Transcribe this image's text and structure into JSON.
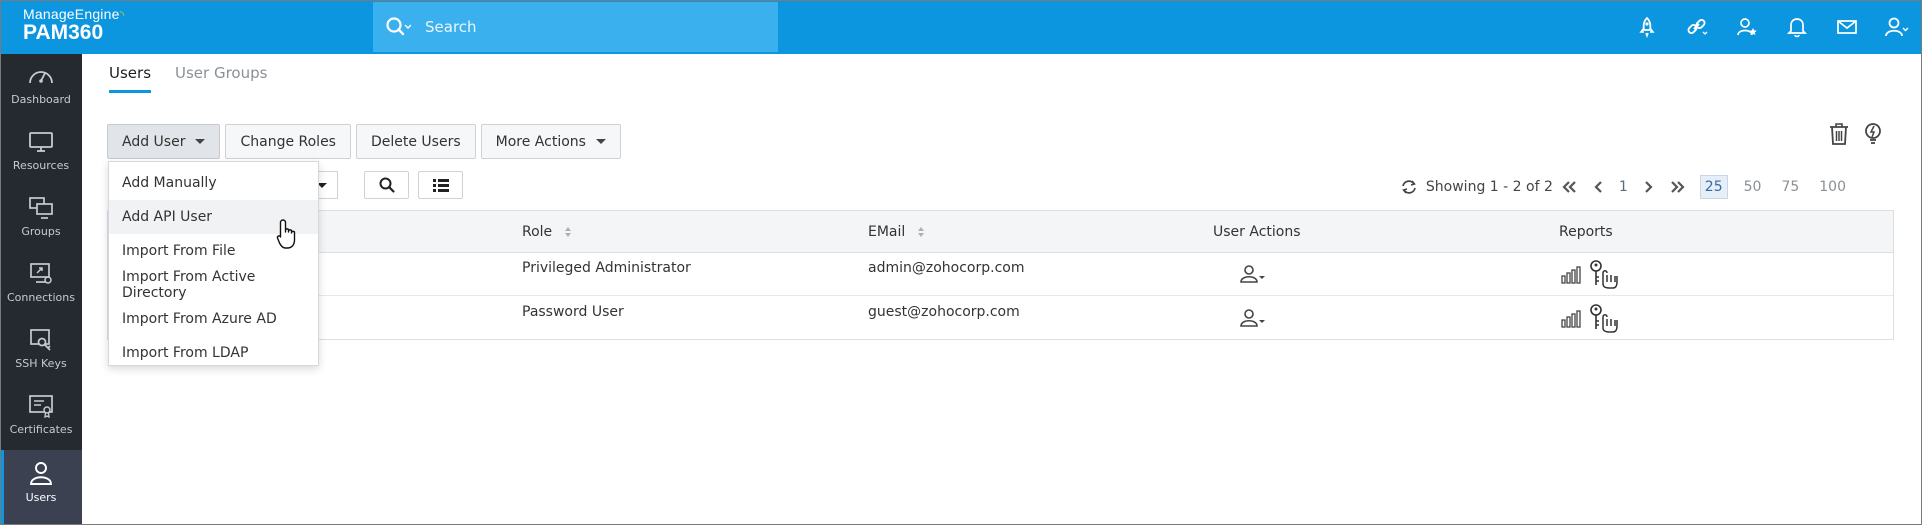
{
  "brand": {
    "vendor": "ManageEngine",
    "product": "PAM360"
  },
  "header": {
    "search_placeholder": "Search",
    "icons": [
      "rocket-icon",
      "link-icon",
      "user-star-icon",
      "bell-icon",
      "mail-icon",
      "user-profile-icon"
    ]
  },
  "sidebar": {
    "items": [
      {
        "label": "Dashboard",
        "icon": "dashboard-icon"
      },
      {
        "label": "Resources",
        "icon": "monitor-icon"
      },
      {
        "label": "Groups",
        "icon": "groups-icon"
      },
      {
        "label": "Connections",
        "icon": "connections-icon"
      },
      {
        "label": "SSH Keys",
        "icon": "ssh-key-icon"
      },
      {
        "label": "Certificates",
        "icon": "certificate-icon"
      },
      {
        "label": "Users",
        "icon": "user-icon",
        "active": true
      }
    ]
  },
  "tabs": [
    {
      "label": "Users",
      "active": true
    },
    {
      "label": "User Groups",
      "active": false
    }
  ],
  "toolbar": {
    "add_user": "Add User",
    "change_roles": "Change Roles",
    "delete_users": "Delete Users",
    "more_actions": "More Actions"
  },
  "add_user_menu": {
    "items": [
      "Add Manually",
      "Add API User",
      "Import From File",
      "Import From Active Directory",
      "Import From Azure AD",
      "Import From LDAP"
    ],
    "hovered_index": 1
  },
  "pagination": {
    "showing": "Showing 1 - 2 of 2",
    "current_page": "1",
    "page_sizes": [
      "25",
      "50",
      "75",
      "100"
    ],
    "selected_page_size": "25"
  },
  "table": {
    "columns": [
      "Role",
      "EMail",
      "User Actions",
      "Reports"
    ],
    "rows": [
      {
        "role": "Privileged Administrator",
        "email": "admin@zohocorp.com"
      },
      {
        "role": "Password User",
        "email": "guest@zohocorp.com"
      }
    ]
  },
  "colors": {
    "header": "#0c96df",
    "search": "#3ab0ee",
    "sidebar": "#252a31",
    "accent": "#0c96df"
  }
}
